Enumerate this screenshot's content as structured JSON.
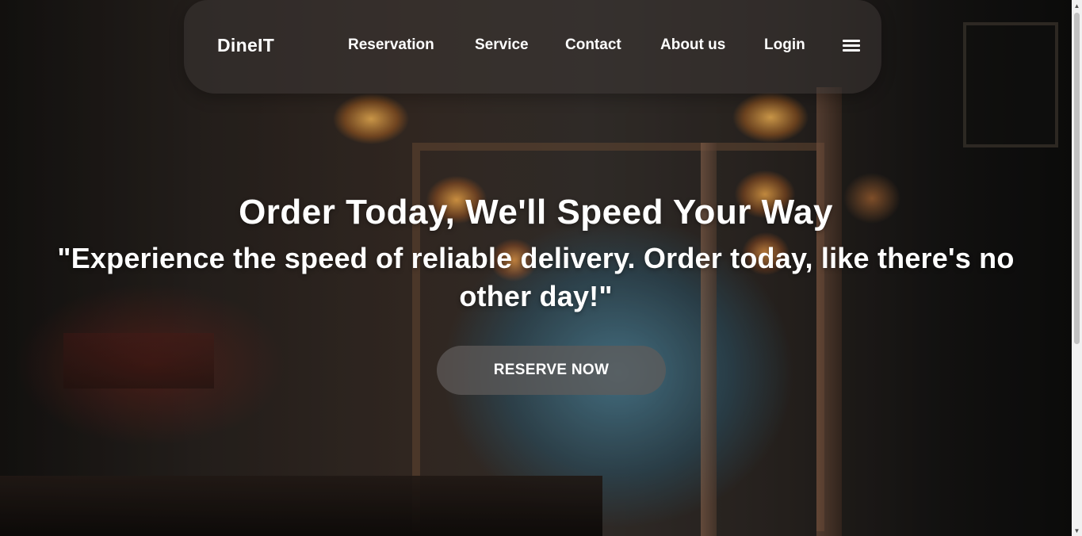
{
  "navbar": {
    "brand": "DineIT",
    "links": [
      {
        "label": "Reservation"
      },
      {
        "label": "Service"
      },
      {
        "label": "Contact"
      },
      {
        "label": "About us"
      },
      {
        "label": "Login"
      }
    ],
    "menu_icon": "hamburger-icon"
  },
  "hero": {
    "title": "Order Today, We'll Speed Your Way",
    "subtitle": "\"Experience the speed of reliable delivery. Order today, like there's no other day!\"",
    "cta_label": "RESERVE NOW",
    "background_image": "restaurant-interior-photo"
  },
  "scrollbar": {
    "up_arrow": "▲",
    "down_arrow": "▼"
  },
  "colors": {
    "text": "#ffffff",
    "navbar_bg": "#3c3734",
    "button_bg": "#5f5c5a"
  }
}
